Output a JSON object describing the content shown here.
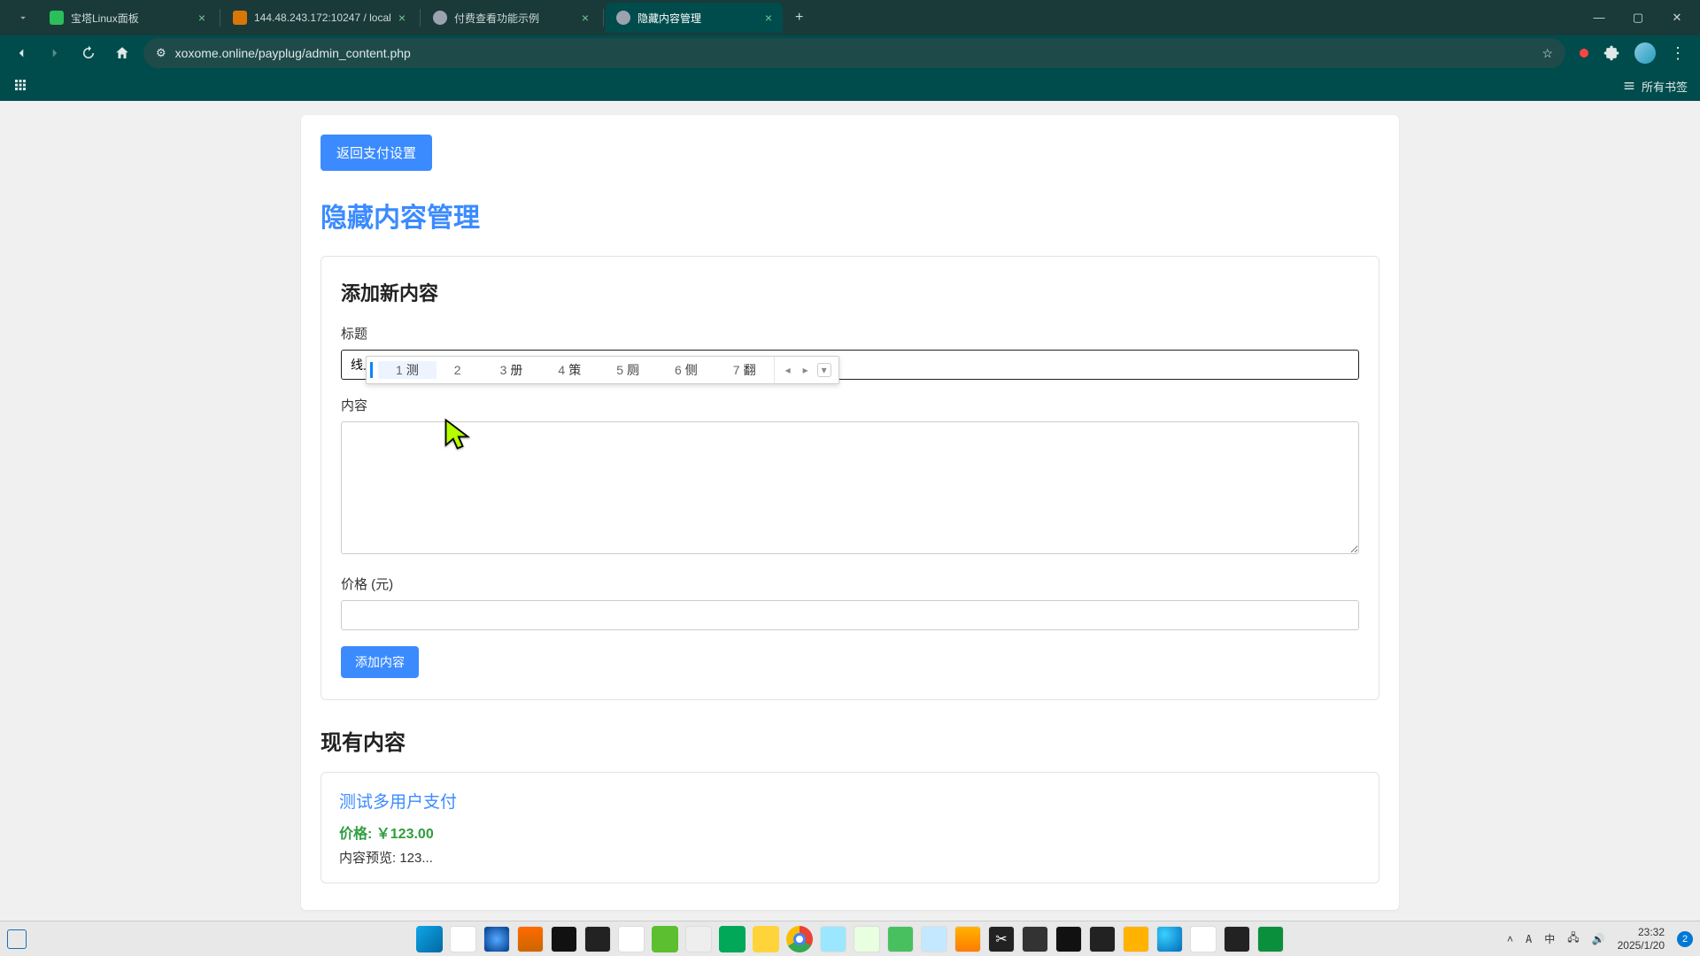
{
  "browser": {
    "tabs": [
      {
        "title": "宝塔Linux面板",
        "favicon": "#2bbf5a"
      },
      {
        "title": "144.48.243.172:10247 / local",
        "favicon": "#d97706"
      },
      {
        "title": "付费查看功能示例",
        "favicon": "#9ca3af"
      },
      {
        "title": "隐藏内容管理",
        "favicon": "#9ca3af",
        "active": true
      }
    ],
    "url": "xoxome.online/payplug/admin_content.php",
    "bookmarks_all": "所有书签"
  },
  "page": {
    "back_button": "返回支付设置",
    "title": "隐藏内容管理",
    "add_card": {
      "heading": "添加新内容",
      "label_title": "标题",
      "title_value": "线上ce",
      "label_content": "内容",
      "content_value": "",
      "label_price": "价格 (元)",
      "price_value": "",
      "submit": "添加内容"
    },
    "ime": {
      "candidates": [
        {
          "n": "1",
          "t": "测"
        },
        {
          "n": "2",
          "t": ""
        },
        {
          "n": "3",
          "t": "册"
        },
        {
          "n": "4",
          "t": "策"
        },
        {
          "n": "5",
          "t": "厕"
        },
        {
          "n": "6",
          "t": "侧"
        },
        {
          "n": "7",
          "t": "翻"
        }
      ]
    },
    "existing": {
      "heading": "现有内容",
      "item": {
        "title": "测试多用户支付",
        "price": "价格: ￥123.00",
        "preview": "内容预览: 123..."
      }
    }
  },
  "taskbar": {
    "time": "23:32",
    "date": "2025/1/20",
    "ime_lang": "中",
    "notif_count": "2",
    "tray": [
      "^",
      "A"
    ]
  }
}
